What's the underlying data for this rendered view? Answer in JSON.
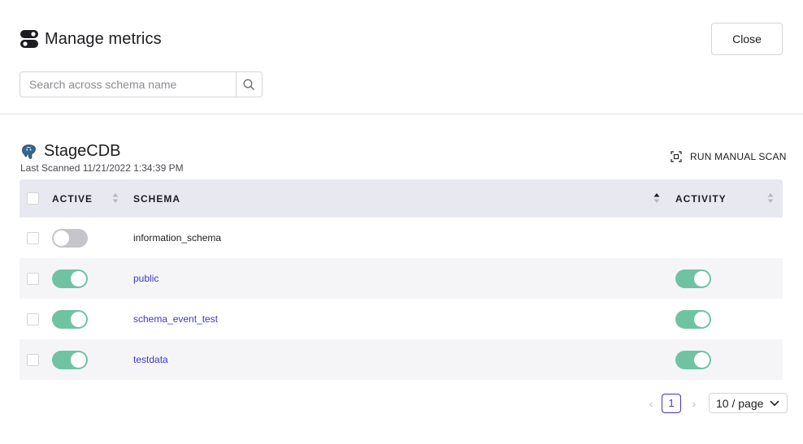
{
  "dialog": {
    "title": "Manage metrics",
    "close_label": "Close"
  },
  "search": {
    "placeholder": "Search across schema name"
  },
  "database": {
    "name": "StageCDB",
    "last_scanned": "Last Scanned 11/21/2022 1:34:39 PM",
    "scan_label": "RUN MANUAL SCAN"
  },
  "table": {
    "headers": {
      "active": "ACTIVE",
      "schema": "SCHEMA",
      "activity": "ACTIVITY"
    },
    "rows": [
      {
        "active": false,
        "schema": "information_schema",
        "activity": null
      },
      {
        "active": true,
        "schema": "public",
        "activity": true
      },
      {
        "active": true,
        "schema": "schema_event_test",
        "activity": true
      },
      {
        "active": true,
        "schema": "testdata",
        "activity": true
      }
    ]
  },
  "pagination": {
    "current_page": "1",
    "page_size": "10 / page"
  },
  "colors": {
    "accent": "#3f37c9",
    "toggle_on": "#6fc3a3",
    "toggle_off": "#c6c6ca",
    "header_bg": "#e8e9f0"
  }
}
